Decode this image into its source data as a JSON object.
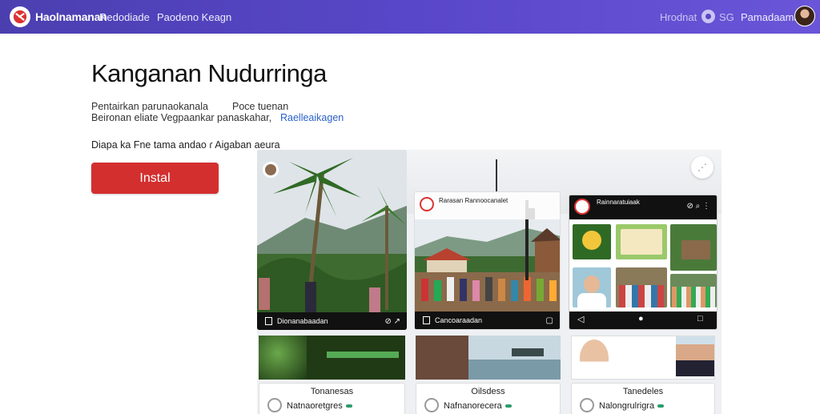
{
  "header": {
    "brand": "Haolnamanan",
    "nav": [
      "Redodiade",
      "Paodeno Keagn"
    ],
    "right_links": [
      "Hrodnat",
      "SG",
      "Pamadaama"
    ],
    "colors": {
      "bar": "#5847c8",
      "accent": "#d32f2f"
    }
  },
  "app": {
    "title": "Kanganan Nudurringa",
    "description_line1": "Pentairkan parunaokanala",
    "description_line1b": "Poce tuenan",
    "description_line2": "Beironan eliate Vegpaankar panaskahar,",
    "description_link": "Raelleaikagen",
    "meta": "Diapa ka Fne tama andao ɾ Aigaban aeura",
    "install_label": "Instal"
  },
  "gallery": {
    "shot1_caption": "Dionanabaadan",
    "shot2_caption": "Cancoaraadan",
    "shot2_header": "Rarasan Rannoocanalet",
    "shot3_header": "Rainnaratuiaak",
    "cards": [
      {
        "title": "Tonanesas",
        "subtitle": "Natnaoretgres"
      },
      {
        "title": "Oilsdess",
        "subtitle": "Nafnanorecera"
      },
      {
        "title": "Tanedeles",
        "subtitle": "Nalongrulrigra"
      }
    ]
  }
}
